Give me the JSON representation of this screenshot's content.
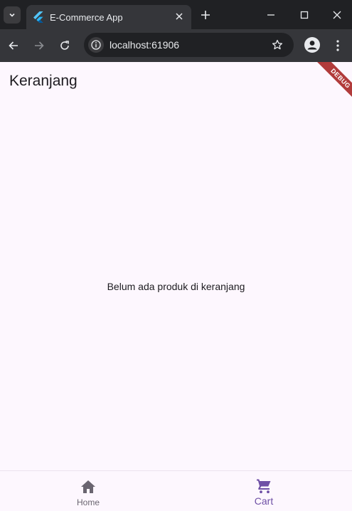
{
  "browser": {
    "tab_title": "E-Commerce App",
    "url": "localhost:61906"
  },
  "app": {
    "title": "Keranjang",
    "empty_message": "Belum ada produk di keranjang",
    "debug_banner": "DEBUG"
  },
  "bottom_nav": {
    "items": [
      {
        "label": "Home",
        "icon": "home-icon",
        "selected": false
      },
      {
        "label": "Cart",
        "icon": "cart-icon",
        "selected": true
      }
    ]
  },
  "colors": {
    "app_background": "#fdf7fe",
    "selected": "#6f50a6",
    "unselected": "#6a6570",
    "debug": "#b13b3b"
  }
}
